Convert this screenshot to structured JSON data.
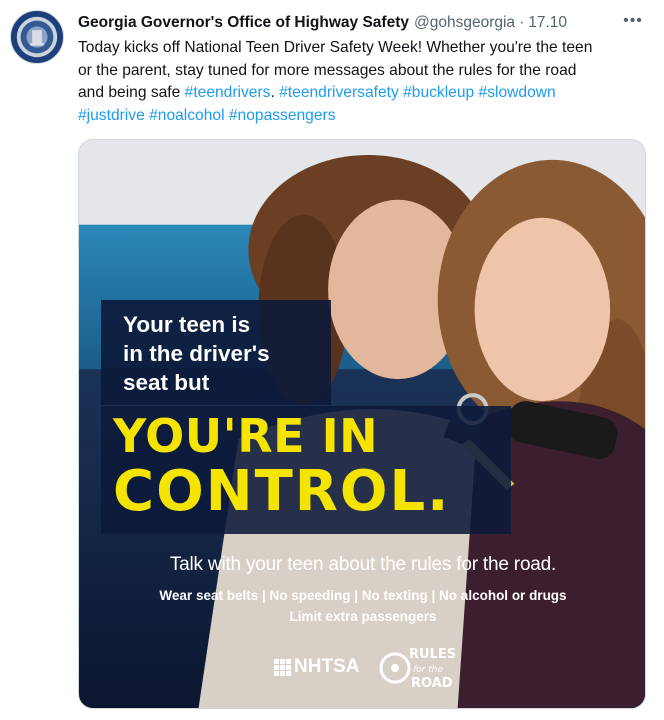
{
  "tweet": {
    "author_name": "Georgia Governor's Office of Highway Safety",
    "handle": "@gohsgeorgia",
    "separator": "·",
    "time": "17.10",
    "more_label": "•••",
    "text_lines": [
      "Today kicks off National Teen Driver Safety Week! Whether you're the teen",
      "or the parent, stay tuned for more messages about the rules for the road",
      "and being safe "
    ],
    "hashtags": [
      "#teendrivers",
      "#teendriversafety",
      "#buckleup",
      "#slowdown",
      "#justdrive",
      "#noalcohol",
      "#nopassengers"
    ]
  },
  "media": {
    "lead_lines": [
      "Your teen is",
      "in the driver's",
      "seat but"
    ],
    "headline_1": "YOU'RE IN",
    "headline_2": "CONTROL.",
    "subtitle": "Talk with your teen about the rules for the road.",
    "rules_line": "Wear seat belts | No speeding | No texting | No alcohol or drugs",
    "rules_line_2": "Limit extra passengers",
    "nhtsa_logo_text": "NHTSA",
    "road_logo_lines": [
      "RULES",
      "for the",
      "ROAD"
    ]
  },
  "colors": {
    "link": "#1d9bf0",
    "headline_yellow": "#f5e400",
    "text_box_navy": "#0c1a3a",
    "muted": "#536471"
  },
  "icons": [
    "avatar-seal-icon",
    "more-options-icon",
    "car-key-icon",
    "nhtsa-logo-icon",
    "rules-road-logo-icon"
  ]
}
